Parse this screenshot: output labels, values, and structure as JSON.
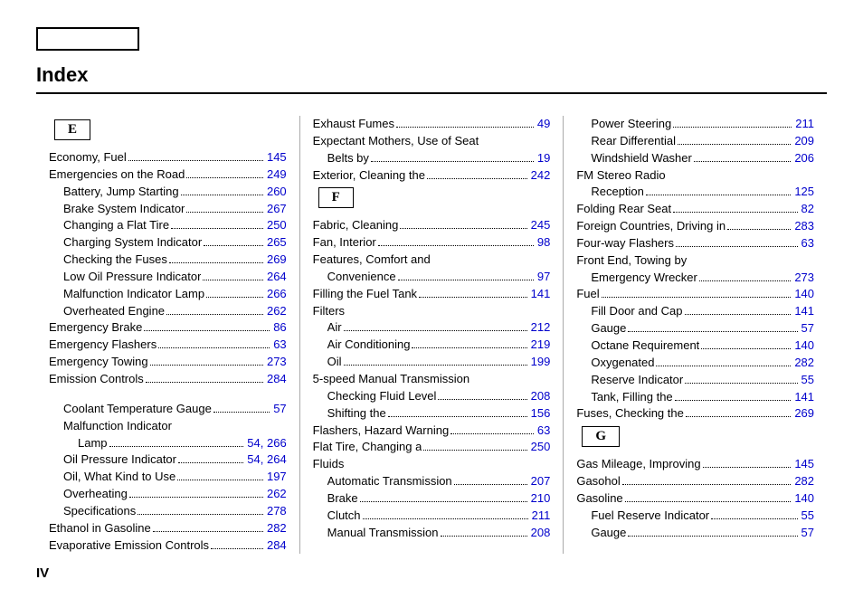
{
  "title": "Index",
  "page_number": "IV",
  "letters": {
    "E": "E",
    "F": "F",
    "G": "G"
  },
  "col1": [
    {
      "t": "Economy, Fuel",
      "p": "145"
    },
    {
      "t": "Emergencies on the Road",
      "p": "249"
    },
    {
      "t": "Battery, Jump Starting",
      "p": "260",
      "s": 1
    },
    {
      "t": "Brake System Indicator",
      "p": "267",
      "s": 1
    },
    {
      "t": "Changing a Flat Tire",
      "p": "250",
      "s": 1
    },
    {
      "t": "Charging System Indicator",
      "p": "265",
      "s": 1
    },
    {
      "t": "Checking the Fuses",
      "p": "269",
      "s": 1
    },
    {
      "t": "Low Oil Pressure Indicator",
      "p": "264",
      "s": 1
    },
    {
      "t": "Malfunction Indicator Lamp",
      "p": "266",
      "s": 1
    },
    {
      "t": "Overheated Engine",
      "p": "262",
      "s": 1
    },
    {
      "t": "Emergency Brake",
      "p": "86"
    },
    {
      "t": "Emergency Flashers",
      "p": "63"
    },
    {
      "t": "Emergency Towing",
      "p": "273"
    },
    {
      "t": "Emission Controls",
      "p": "284"
    },
    {
      "spacer": true
    },
    {
      "t": "Coolant Temperature Gauge",
      "p": "57",
      "s": 1
    },
    {
      "t": "Malfunction Indicator",
      "s": 1,
      "np": true
    },
    {
      "t": "Lamp",
      "p": "54, 266",
      "s": 2
    },
    {
      "t": "Oil Pressure Indicator",
      "p": "54, 264",
      "s": 1
    },
    {
      "t": "Oil, What Kind to Use",
      "p": "197",
      "s": 1
    },
    {
      "t": "Overheating",
      "p": "262",
      "s": 1
    },
    {
      "t": "Specifications",
      "p": "278",
      "s": 1
    },
    {
      "t": "Ethanol in Gasoline",
      "p": "282"
    },
    {
      "t": "Evaporative Emission Controls",
      "p": "284"
    }
  ],
  "col2": [
    {
      "t": "Exhaust Fumes",
      "p": "49"
    },
    {
      "t": "Expectant Mothers, Use of Seat",
      "np": true
    },
    {
      "t": "Belts by",
      "p": "19",
      "s": 1
    },
    {
      "t": "Exterior, Cleaning the",
      "p": "242"
    },
    {
      "letter": "F"
    },
    {
      "t": "Fabric, Cleaning",
      "p": "245"
    },
    {
      "t": "Fan, Interior",
      "p": "98"
    },
    {
      "t": "Features, Comfort and",
      "np": true
    },
    {
      "t": "Convenience",
      "p": "97",
      "s": 1
    },
    {
      "t": "Filling the Fuel Tank",
      "p": "141"
    },
    {
      "t": "Filters",
      "np": true
    },
    {
      "t": "Air",
      "p": "212",
      "s": 1
    },
    {
      "t": "Air Conditioning",
      "p": "219",
      "s": 1
    },
    {
      "t": "Oil",
      "p": "199",
      "s": 1
    },
    {
      "t": "5-speed Manual Transmission",
      "np": true
    },
    {
      "t": "Checking Fluid Level",
      "p": "208",
      "s": 1
    },
    {
      "t": "Shifting the",
      "p": "156",
      "s": 1
    },
    {
      "t": "Flashers, Hazard Warning",
      "p": "63"
    },
    {
      "t": "Flat Tire, Changing a",
      "p": "250"
    },
    {
      "t": "Fluids",
      "np": true
    },
    {
      "t": "Automatic Transmission",
      "p": "207",
      "s": 1
    },
    {
      "t": "Brake",
      "p": "210",
      "s": 1
    },
    {
      "t": "Clutch",
      "p": "211",
      "s": 1
    },
    {
      "t": "Manual Transmission",
      "p": "208",
      "s": 1
    }
  ],
  "col3": [
    {
      "t": "Power Steering",
      "p": "211",
      "s": 1
    },
    {
      "t": "Rear Differential",
      "p": "209",
      "s": 1
    },
    {
      "t": "Windshield Washer",
      "p": "206",
      "s": 1
    },
    {
      "t": "FM Stereo Radio",
      "np": true
    },
    {
      "t": "Reception",
      "p": "125",
      "s": 1
    },
    {
      "t": "Folding Rear Seat",
      "p": "82"
    },
    {
      "t": "Foreign Countries, Driving in",
      "p": "283"
    },
    {
      "t": "Four-way Flashers",
      "p": "63"
    },
    {
      "t": "Front End, Towing by",
      "np": true
    },
    {
      "t": "Emergency Wrecker",
      "p": "273",
      "s": 1
    },
    {
      "t": "Fuel",
      "p": "140"
    },
    {
      "t": "Fill Door and Cap",
      "p": "141",
      "s": 1
    },
    {
      "t": "Gauge",
      "p": "57",
      "s": 1
    },
    {
      "t": "Octane Requirement",
      "p": "140",
      "s": 1
    },
    {
      "t": "Oxygenated",
      "p": "282",
      "s": 1
    },
    {
      "t": "Reserve Indicator",
      "p": "55",
      "s": 1
    },
    {
      "t": "Tank, Filling the",
      "p": "141",
      "s": 1
    },
    {
      "t": "Fuses, Checking the",
      "p": "269"
    },
    {
      "letter": "G"
    },
    {
      "t": "Gas Mileage, Improving",
      "p": "145"
    },
    {
      "t": "Gasohol",
      "p": "282"
    },
    {
      "t": "Gasoline",
      "p": "140"
    },
    {
      "t": "Fuel Reserve Indicator",
      "p": "55",
      "s": 1
    },
    {
      "t": "Gauge",
      "p": "57",
      "s": 1
    }
  ]
}
